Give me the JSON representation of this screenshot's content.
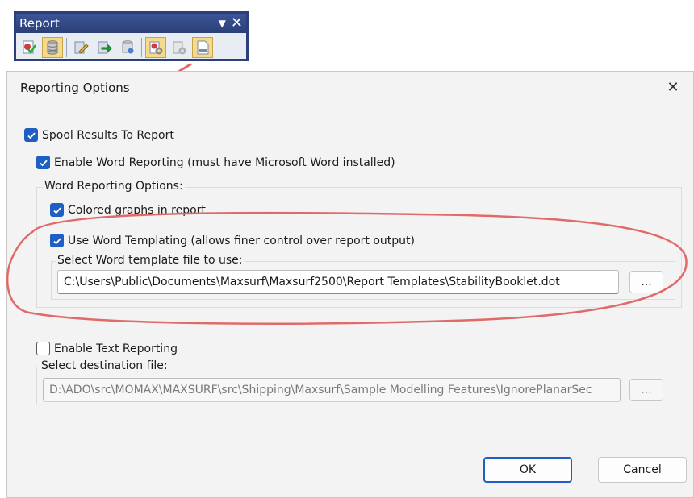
{
  "toolbar": {
    "title": "Report",
    "pin_glyph": "▼",
    "close_glyph": "✕",
    "icons": [
      {
        "name": "report-spool-icon",
        "active": false
      },
      {
        "name": "report-database-icon",
        "active": true
      },
      {
        "name": "report-edit-icon",
        "active": false
      },
      {
        "name": "report-export-icon",
        "active": false
      },
      {
        "name": "report-list-icon",
        "active": false
      },
      {
        "name": "report-settings-icon",
        "active": true
      },
      {
        "name": "report-gear-disabled-icon",
        "active": false
      },
      {
        "name": "report-document-icon",
        "active": true
      }
    ]
  },
  "dialog": {
    "title": "Reporting Options",
    "close_glyph": "✕",
    "spool": {
      "label": "Spool Results To Report",
      "checked": true
    },
    "word": {
      "label": "Enable Word Reporting (must have Microsoft Word installed)",
      "checked": true
    },
    "word_options": {
      "legend": "Word Reporting Options:",
      "colored": {
        "label": "Colored graphs in report",
        "checked": true
      },
      "templating": {
        "label": "Use Word Templating (allows finer control over report output)",
        "checked": true
      },
      "template_group": {
        "legend": "Select Word template file to use:",
        "path": "C:\\Users\\Public\\Documents\\Maxsurf\\Maxsurf2500\\Report Templates\\StabilityBooklet.dot",
        "browse": "..."
      }
    },
    "text": {
      "label": "Enable Text Reporting",
      "checked": false
    },
    "text_dest": {
      "legend": "Select destination file:",
      "path": "D:\\ADO\\src\\MOMAX\\MAXSURF\\src\\Shipping\\Maxsurf\\Sample Modelling Features\\IgnorePlanarSec",
      "browse": "..."
    },
    "ok": "OK",
    "cancel": "Cancel"
  },
  "colors": {
    "accent": "#1f5fc4",
    "annotation": "#e06a6a",
    "toolbar_frame": "#2b3f78"
  }
}
